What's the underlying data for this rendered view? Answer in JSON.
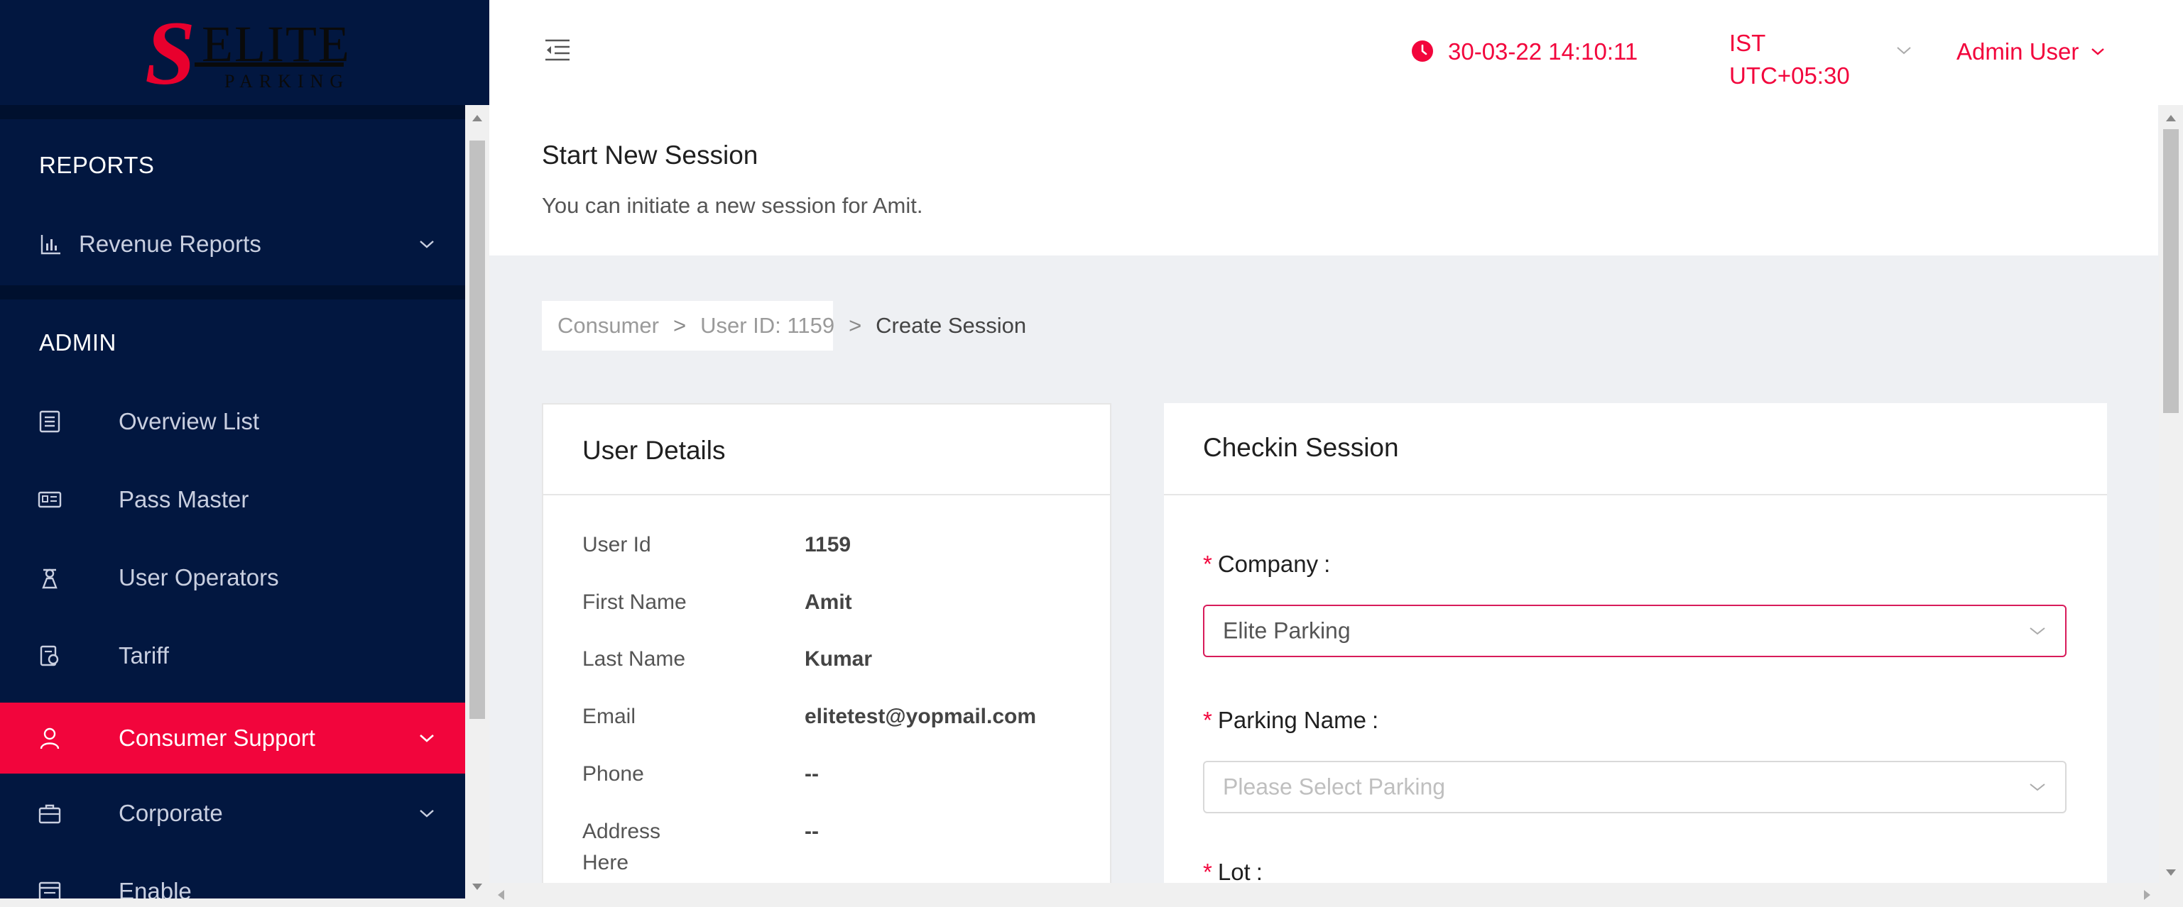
{
  "app": {
    "logo": {
      "mark": "S",
      "brand": "ELITE",
      "sub": "PARKING"
    },
    "colors": {
      "accent": "#f2053c",
      "sidebar_bg": "#021740",
      "sidebar_band": "#00102e"
    }
  },
  "header": {
    "datetime": "30-03-22 14:10:11",
    "tz_line1": "IST",
    "tz_line2": "UTC+05:30",
    "user": "Admin User",
    "icons": [
      "menu-fold-icon",
      "clock-icon",
      "chevron-down-icon"
    ]
  },
  "sidebar": {
    "reports_title": "REPORTS",
    "admin_title": "ADMIN",
    "items": [
      {
        "label": "Revenue Reports",
        "icon": "bar-chart-icon"
      },
      {
        "label": "Overview List",
        "icon": "list-icon"
      },
      {
        "label": "Pass Master",
        "icon": "id-card-icon"
      },
      {
        "label": "User Operators",
        "icon": "operator-icon"
      },
      {
        "label": "Tariff",
        "icon": "tariff-icon"
      },
      {
        "label": "Consumer Support",
        "icon": "user-icon",
        "active": true
      },
      {
        "label": "Corporate",
        "icon": "briefcase-icon"
      },
      {
        "label": "Enable",
        "icon": "enable-icon"
      }
    ]
  },
  "page": {
    "title": "Start New Session",
    "subtitle": "You can initiate a new session for Amit."
  },
  "breadcrumb": {
    "items": [
      "Consumer",
      "User ID: 1159",
      "Create Session"
    ],
    "separator": ">"
  },
  "user_details": {
    "title": "User Details",
    "rows": [
      {
        "key": "User Id",
        "value": "1159"
      },
      {
        "key": "First Name",
        "value": "Amit"
      },
      {
        "key": "Last Name",
        "value": "Kumar"
      },
      {
        "key": "Email",
        "value": "elitetest@yopmail.com"
      },
      {
        "key": "Phone",
        "value": "--"
      },
      {
        "key": "Address Here",
        "value": "--"
      }
    ]
  },
  "checkin": {
    "title": "Checkin Session",
    "required_mark": "*",
    "colon": ":",
    "company_label": "Company",
    "company_value": "Elite Parking",
    "parking_label": "Parking Name",
    "parking_placeholder": "Please Select Parking",
    "lot_label": "Lot"
  }
}
